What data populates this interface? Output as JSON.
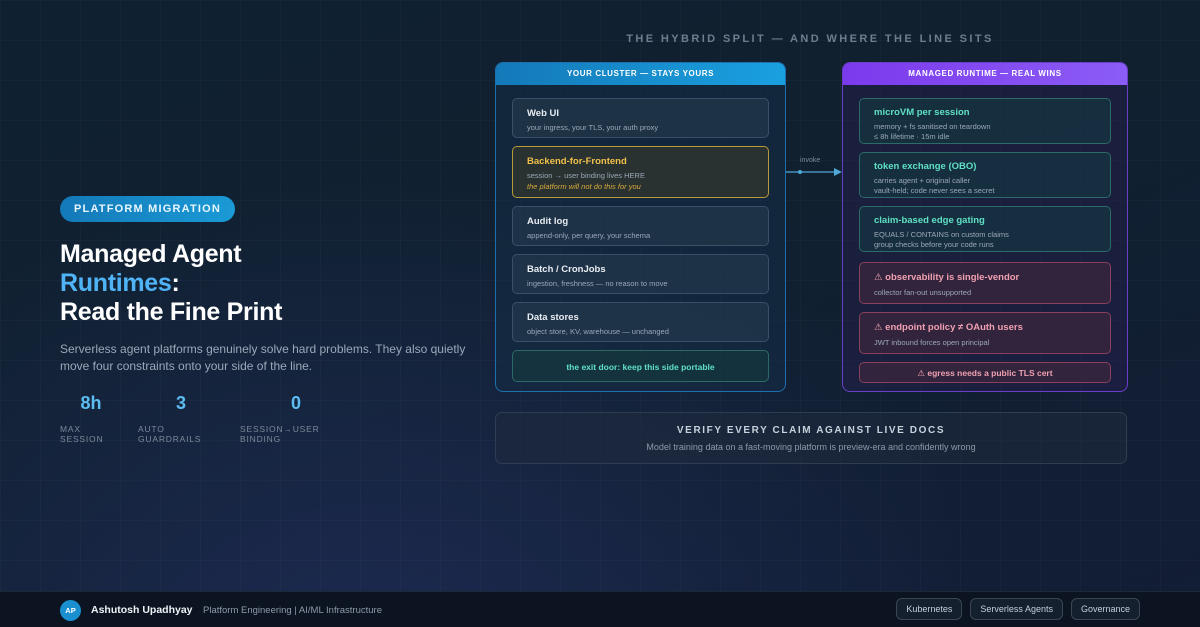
{
  "left": {
    "badge": "PLATFORM MIGRATION",
    "title_line1": "Managed Agent",
    "title_line2_accent": "Runtimes",
    "title_line2_rest": ":",
    "title_line3": "Read the Fine Print",
    "lede": "Serverless agent platforms genuinely solve hard problems. They also quietly move four constraints onto your side of the line.",
    "stats": [
      {
        "value": "8h",
        "label": "MAX SESSION"
      },
      {
        "value": "3",
        "label": "AUTO GUARDRAILS"
      },
      {
        "value": "0",
        "label": "SESSION→USER BINDING"
      }
    ]
  },
  "diagram": {
    "heading": "THE HYBRID SPLIT — AND WHERE THE LINE SITS",
    "connector_label": "invoke",
    "cluster": {
      "header": "YOUR CLUSTER — STAYS YOURS",
      "items": [
        {
          "title": "Web UI",
          "sub": "your ingress, your TLS, your auth proxy"
        },
        {
          "title": "Backend-for-Frontend",
          "sub": "session → user binding lives HERE",
          "note": "the platform will not do this for you"
        },
        {
          "title": "Audit log",
          "sub": "append-only, per query, your schema"
        },
        {
          "title": "Batch / CronJobs",
          "sub": "ingestion, freshness — no reason to move"
        },
        {
          "title": "Data stores",
          "sub": "object store, KV, warehouse — unchanged"
        }
      ],
      "exit": "the exit door: keep this side portable"
    },
    "managed": {
      "header": "MANAGED RUNTIME — REAL WINS",
      "items": [
        {
          "title": "microVM per session",
          "sub": "memory + fs sanitised on teardown",
          "sub2": "≤ 8h lifetime · 15m idle"
        },
        {
          "title": "token exchange (OBO)",
          "sub": "carries agent + original caller",
          "sub2": "vault-held; code never sees a secret"
        },
        {
          "title": "claim-based edge gating",
          "sub": "EQUALS / CONTAINS on custom claims",
          "sub2": "group checks before your code runs"
        }
      ],
      "warnings": [
        {
          "title": "⚠ observability is single-vendor",
          "sub": "collector fan-out unsupported"
        },
        {
          "title": "⚠ endpoint policy ≠ OAuth users",
          "sub": "JWT inbound forces open principal"
        }
      ],
      "egress": "⚠ egress needs a public TLS cert"
    }
  },
  "verify": {
    "title": "VERIFY EVERY CLAIM AGAINST LIVE DOCS",
    "sub": "Model training data on a fast-moving platform is preview-era and confidently wrong"
  },
  "footer": {
    "initials": "AP",
    "author": "Ashutosh Upadhyay",
    "role": "Platform Engineering | AI/ML Infrastructure",
    "tags": [
      "Kubernetes",
      "Serverless Agents",
      "Governance"
    ]
  },
  "colors": {
    "cluster_accent": "#1aa0e0",
    "managed_accent": "#8b5cf6",
    "highlight": "#f2c04a",
    "positive": "#5fe0c6",
    "warning": "#f0a0b0"
  }
}
